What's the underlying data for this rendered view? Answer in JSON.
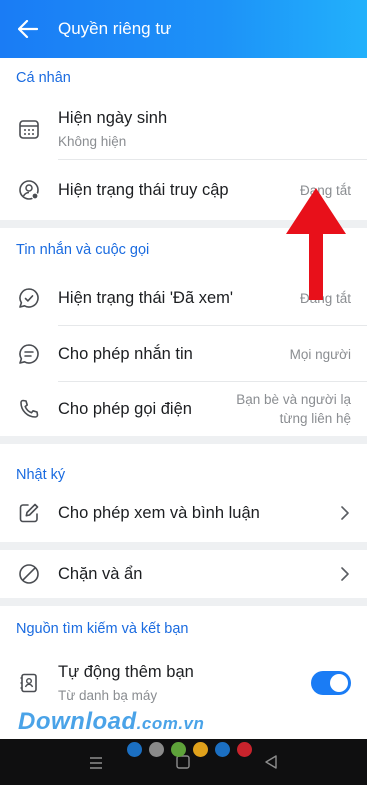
{
  "header": {
    "title": "Quyền riêng tư"
  },
  "sections": {
    "personal": {
      "title": "Cá nhân",
      "birthday": {
        "label": "Hiện ngày sinh",
        "sub": "Không hiện"
      },
      "access_status": {
        "label": "Hiện trạng thái truy cập",
        "value": "Đang tắt"
      }
    },
    "messages": {
      "title": "Tin nhắn và cuộc gọi",
      "seen_status": {
        "label": "Hiện trạng thái 'Đã xem'",
        "value": "Đang tắt"
      },
      "allow_message": {
        "label": "Cho phép nhắn tin",
        "value": "Mọi người"
      },
      "allow_call": {
        "label": "Cho phép gọi điện",
        "value_line1": "Bạn bè và người lạ",
        "value_line2": "từng liên hệ"
      }
    },
    "diary": {
      "title": "Nhật ký",
      "view_comment": {
        "label": "Cho phép xem và bình luận"
      }
    },
    "block": {
      "label": "Chặn và ẩn"
    },
    "search": {
      "title": "Nguồn tìm kiếm và kết bạn",
      "auto_add": {
        "label": "Tự động thêm bạn",
        "sub": "Từ danh bạ máy",
        "enabled": true
      }
    }
  },
  "watermark": {
    "main": "Download",
    "suffix": ".com.vn"
  },
  "colors": {
    "accent": "#1a7cf5",
    "section_title": "#1a6be0",
    "arrow": "#e8101a"
  },
  "dots_colors": [
    "#1b6fc2",
    "#8a8a8a",
    "#5ea33a",
    "#e0a11b",
    "#1b6fc2",
    "#c8232c"
  ]
}
